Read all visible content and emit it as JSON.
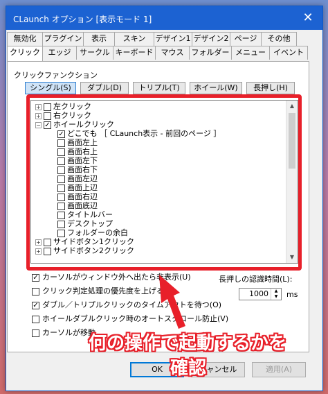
{
  "window": {
    "title": "CLaunch オプション [表示モード 1]"
  },
  "tabs_top": [
    "無効化",
    "プラグイン",
    "表示",
    "スキン",
    "デザイン1",
    "デザイン2",
    "ページ",
    "その他"
  ],
  "tabs_bottom": [
    "クリック",
    "エッジ",
    "サークル",
    "キーボード",
    "マウス",
    "フォルダー",
    "メニュー",
    "イベント"
  ],
  "group_label": "クリックファンクション",
  "subtabs": [
    "シングル(S)",
    "ダブル(D)",
    "トリプル(T)",
    "ホイール(W)",
    "長押し(H)"
  ],
  "tree": [
    {
      "label": "左クリック"
    },
    {
      "label": "右クリック"
    },
    {
      "label": "ホイールクリック"
    },
    {
      "label": "どこでも ［ CLaunch表示 - 前回のページ ］"
    },
    {
      "label": "画面左上"
    },
    {
      "label": "画面右上"
    },
    {
      "label": "画面左下"
    },
    {
      "label": "画面右下"
    },
    {
      "label": "画面左辺"
    },
    {
      "label": "画面上辺"
    },
    {
      "label": "画面右辺"
    },
    {
      "label": "画面底辺"
    },
    {
      "label": "タイトルバー"
    },
    {
      "label": "デスクトップ"
    },
    {
      "label": "フォルダーの余白"
    },
    {
      "label": "サイドボタン1クリック"
    },
    {
      "label": "サイドボタン2クリック"
    }
  ],
  "options": [
    "カーソルがウィンドウ外へ出たら非表示(U)",
    "クリック判定処理の優先度を上げる(P)",
    "ダブル／トリプルクリックのタイムアウトを待つ(O)",
    "ホイールダブルクリック時のオートスクロール防止(V)",
    "カーソルが移動"
  ],
  "long_press": {
    "label": "長押しの認識時間(L):",
    "value": "1000",
    "unit": "ms"
  },
  "buttons": {
    "ok": "OK",
    "cancel": "キャンセル",
    "apply": "適用(A)"
  },
  "annotation": {
    "line1": "何の操作で起動するかを",
    "line2": "確認"
  },
  "colors": {
    "accent": "#e8202a",
    "titlebar": "#1c62d2"
  }
}
